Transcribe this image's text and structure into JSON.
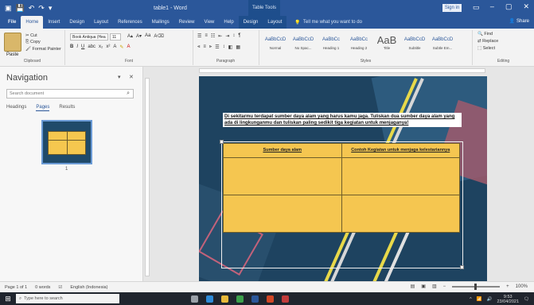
{
  "window": {
    "title": "table1 - Word",
    "table_tools": "Table Tools",
    "sign_in": "Sign in"
  },
  "tabs": [
    {
      "label": "File"
    },
    {
      "label": "Home"
    },
    {
      "label": "Insert"
    },
    {
      "label": "Design"
    },
    {
      "label": "Layout"
    },
    {
      "label": "References"
    },
    {
      "label": "Mailings"
    },
    {
      "label": "Review"
    },
    {
      "label": "View"
    },
    {
      "label": "Help"
    },
    {
      "label": "Design"
    },
    {
      "label": "Layout"
    }
  ],
  "tell_me": "Tell me what you want to do",
  "share": "Share",
  "ribbon": {
    "clipboard": {
      "paste": "Paste",
      "cut": "Cut",
      "copy": "Copy",
      "format_painter": "Format Painter",
      "label": "Clipboard"
    },
    "font": {
      "name": "Book Antiqua (Hea",
      "size": "11",
      "bold": "B",
      "italic": "I",
      "underline": "U",
      "label": "Font"
    },
    "paragraph": {
      "label": "Paragraph"
    },
    "styles": {
      "label": "Styles",
      "items": [
        {
          "sample": "AaBbCcD",
          "name": "Normal"
        },
        {
          "sample": "AaBbCcD",
          "name": "No Spac..."
        },
        {
          "sample": "AaBbCc",
          "name": "Heading 1"
        },
        {
          "sample": "AaBbCc",
          "name": "Heading 2"
        },
        {
          "sample": "AaB",
          "name": "Title"
        },
        {
          "sample": "AaBbCcD",
          "name": "Subtitle"
        },
        {
          "sample": "AaBbCcD",
          "name": "Subtle Em..."
        }
      ]
    },
    "editing": {
      "find": "Find",
      "replace": "Replace",
      "select": "Select",
      "label": "Editing"
    }
  },
  "navigation": {
    "title": "Navigation",
    "search_placeholder": "Search document",
    "tabs": [
      {
        "label": "Headings"
      },
      {
        "label": "Pages"
      },
      {
        "label": "Results"
      }
    ],
    "page_number": "1"
  },
  "document": {
    "instruction": "Di sekitarmu terdapat sumber daya alam yang harus kamu jaga. Tuliskan dua sumber daya alam yang ada di lingkunganmu dan tuliskan paling sedikit tiga kegiatan untuk menjaganya!",
    "table": {
      "headers": [
        "Sumber daya alam",
        "Contoh Kegiatan untuk menjaga kelestariannya"
      ]
    }
  },
  "status": {
    "page": "Page 1 of 1",
    "words": "0 words",
    "language": "English (Indonesia)",
    "zoom": "100%"
  },
  "taskbar": {
    "search_placeholder": "Type here to search",
    "time": "9:53",
    "date": "23/04/2021"
  },
  "colors": {
    "word_blue": "#2b579a",
    "slide_bg": "#1e4360",
    "table_fill": "#f5c650"
  }
}
